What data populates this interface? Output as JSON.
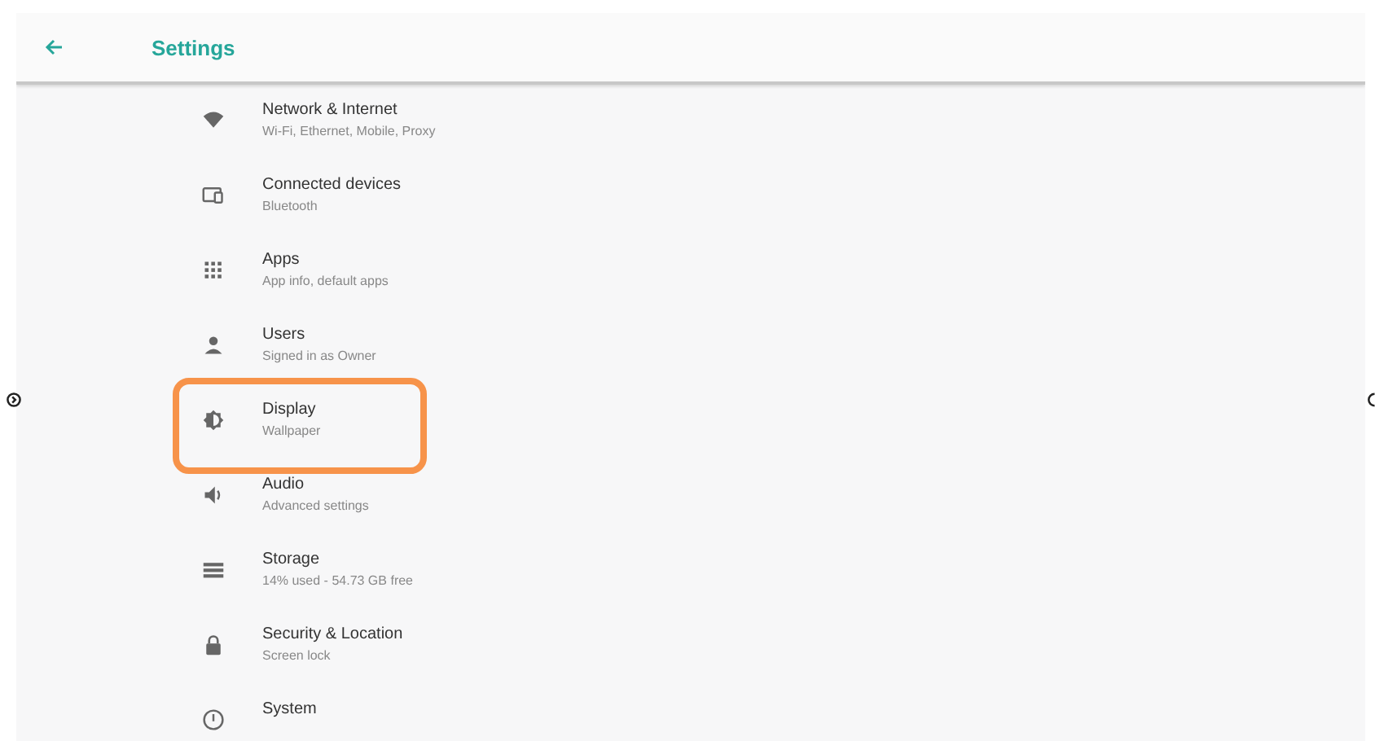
{
  "app_bar": {
    "title": "Settings"
  },
  "items": [
    {
      "kind": "wifi",
      "title": "Network & Internet",
      "subtitle": "Wi-Fi, Ethernet, Mobile, Proxy",
      "highlighted": false
    },
    {
      "kind": "devices",
      "title": "Connected devices",
      "subtitle": "Bluetooth",
      "highlighted": false
    },
    {
      "kind": "apps",
      "title": "Apps",
      "subtitle": "App info, default apps",
      "highlighted": false
    },
    {
      "kind": "user",
      "title": "Users",
      "subtitle": "Signed in as Owner",
      "highlighted": false
    },
    {
      "kind": "brightness",
      "title": "Display",
      "subtitle": "Wallpaper",
      "highlighted": true
    },
    {
      "kind": "volume",
      "title": "Audio",
      "subtitle": "Advanced settings",
      "highlighted": false
    },
    {
      "kind": "storage",
      "title": "Storage",
      "subtitle": "14% used - 54.73 GB free",
      "highlighted": false
    },
    {
      "kind": "lock",
      "title": "Security & Location",
      "subtitle": "Screen lock",
      "highlighted": false
    },
    {
      "kind": "info",
      "title": "System",
      "highlighted": false
    }
  ]
}
